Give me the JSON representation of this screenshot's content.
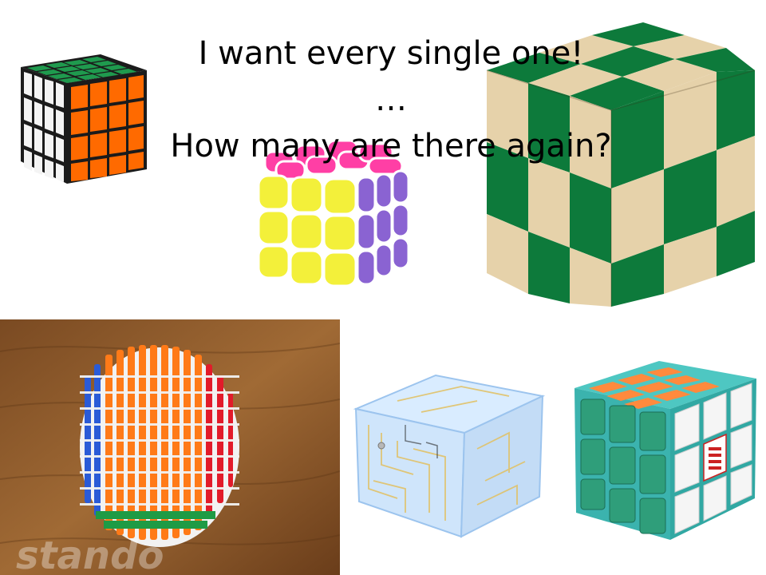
{
  "slide": {
    "title_lines": [
      "I want every single one!",
      "…",
      "How many are there again?"
    ],
    "watermark": "stando"
  },
  "colors": {
    "cube_black": "#1b1b1b",
    "orange": "#ff6a00",
    "green_dark": "#0d7a3b",
    "wood": "#e6d2aa",
    "pillow_yellow": "#f3f03a",
    "pillow_purple": "#8a63d2",
    "pillow_pink": "#ff3fa5",
    "teal_green": "#2f9e7a",
    "floor_wood": "#8b5a2b"
  },
  "pictures": [
    {
      "name": "4x4-cube-photo",
      "icon": "rubik-4x4-icon"
    },
    {
      "name": "pillow-3x3-cube-photo",
      "icon": "pillow-cube-icon"
    },
    {
      "name": "wooden-snake-cube-photo",
      "icon": "wood-snake-cube-icon"
    },
    {
      "name": "barrel-big-cube-photo",
      "icon": "barrel-cube-icon"
    },
    {
      "name": "maze-cube-photo",
      "icon": "maze-cube-icon"
    },
    {
      "name": "teal-3x3-cube-photo",
      "icon": "teal-cube-icon"
    }
  ]
}
